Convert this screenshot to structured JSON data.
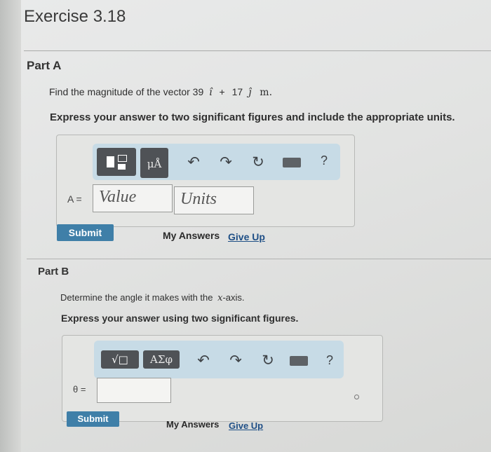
{
  "title": "Exercise 3.18",
  "partA": {
    "label": "Part A",
    "question_prefix": "Find the magnitude of the vector 39",
    "i_hat": "î",
    "plus": "+",
    "coef2": "17",
    "j_hat": "ĵ",
    "unit": "m.",
    "instruction": "Express your answer to two significant figures and include the appropriate units.",
    "toolbar": {
      "unit_btn": "μÅ",
      "help": "?"
    },
    "eq_label": "A =",
    "value_placeholder": "Value",
    "units_placeholder": "Units",
    "submit": "Submit",
    "my_answers": "My Answers",
    "give_up": "Give Up"
  },
  "partB": {
    "label": "Part B",
    "question_prefix": "Determine the angle it makes with the",
    "axis_var": "x",
    "question_suffix": "-axis.",
    "instruction": "Express your answer using two significant figures.",
    "toolbar": {
      "sqrt_btn": "√□",
      "greek_btn": "ΑΣφ",
      "help": "?"
    },
    "eq_label": "θ =",
    "submit": "Submit",
    "my_answers": "My Answers",
    "give_up": "Give Up"
  },
  "colors": {
    "submit": "#3f7fa8",
    "toolbar": "#c7dbe6",
    "dark_button": "#4f5256"
  }
}
